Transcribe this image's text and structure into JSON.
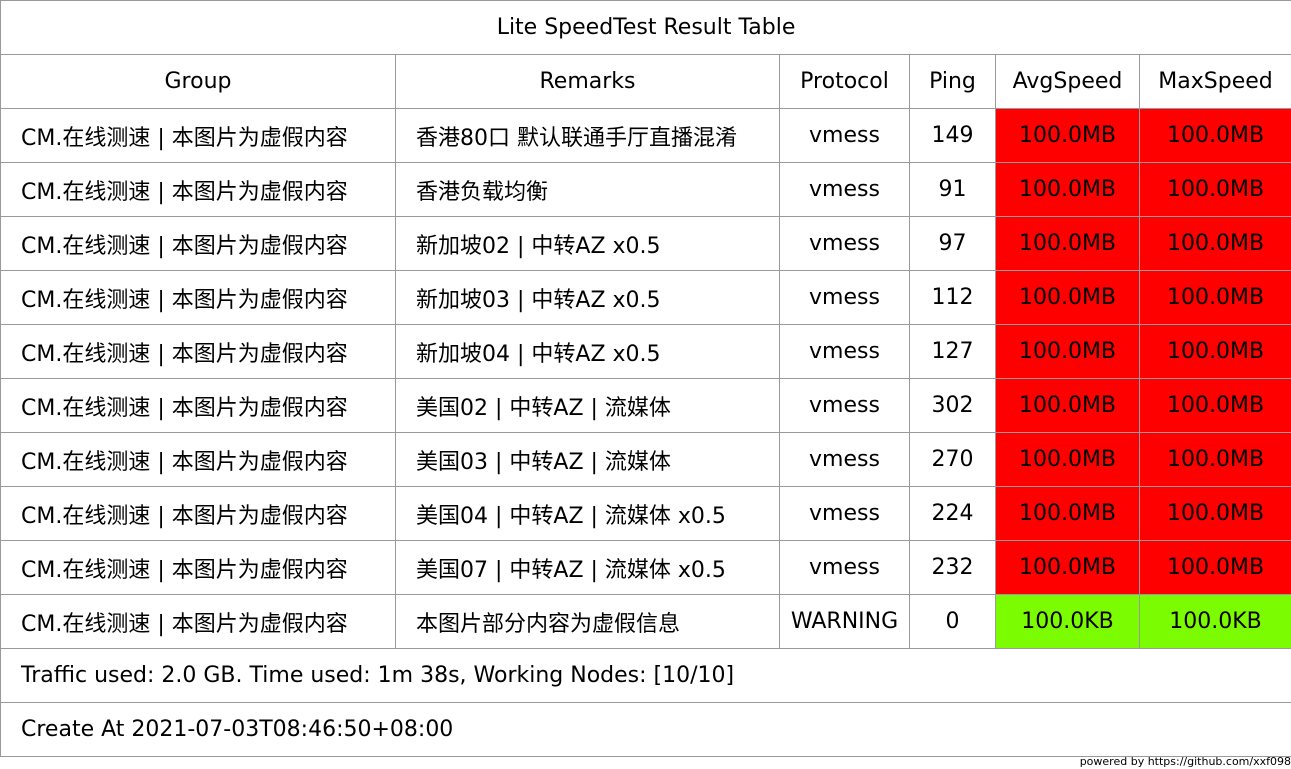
{
  "title": "Lite SpeedTest Result Table",
  "columns": [
    "Group",
    "Remarks",
    "Protocol",
    "Ping",
    "AvgSpeed",
    "MaxSpeed"
  ],
  "colors": {
    "speed_high": "#ff0000",
    "speed_low": "#7cfc00",
    "border": "#9a9a9a"
  },
  "rows": [
    {
      "group": "CM.在线测速 | 本图片为虚假内容",
      "remarks": "香港80口 默认联通手厅直播混淆",
      "protocol": "vmess",
      "ping": "149",
      "avg": "100.0MB",
      "max": "100.0MB",
      "speed_level": "high"
    },
    {
      "group": "CM.在线测速 | 本图片为虚假内容",
      "remarks": "香港负载均衡",
      "protocol": "vmess",
      "ping": "91",
      "avg": "100.0MB",
      "max": "100.0MB",
      "speed_level": "high"
    },
    {
      "group": "CM.在线测速 | 本图片为虚假内容",
      "remarks": "新加坡02 | 中转AZ x0.5",
      "protocol": "vmess",
      "ping": "97",
      "avg": "100.0MB",
      "max": "100.0MB",
      "speed_level": "high"
    },
    {
      "group": "CM.在线测速 | 本图片为虚假内容",
      "remarks": "新加坡03 | 中转AZ x0.5",
      "protocol": "vmess",
      "ping": "112",
      "avg": "100.0MB",
      "max": "100.0MB",
      "speed_level": "high"
    },
    {
      "group": "CM.在线测速 | 本图片为虚假内容",
      "remarks": "新加坡04 | 中转AZ x0.5",
      "protocol": "vmess",
      "ping": "127",
      "avg": "100.0MB",
      "max": "100.0MB",
      "speed_level": "high"
    },
    {
      "group": "CM.在线测速 | 本图片为虚假内容",
      "remarks": "美国02 | 中转AZ | 流媒体",
      "protocol": "vmess",
      "ping": "302",
      "avg": "100.0MB",
      "max": "100.0MB",
      "speed_level": "high"
    },
    {
      "group": "CM.在线测速 | 本图片为虚假内容",
      "remarks": "美国03 | 中转AZ | 流媒体",
      "protocol": "vmess",
      "ping": "270",
      "avg": "100.0MB",
      "max": "100.0MB",
      "speed_level": "high"
    },
    {
      "group": "CM.在线测速 | 本图片为虚假内容",
      "remarks": "美国04 | 中转AZ | 流媒体 x0.5",
      "protocol": "vmess",
      "ping": "224",
      "avg": "100.0MB",
      "max": "100.0MB",
      "speed_level": "high"
    },
    {
      "group": "CM.在线测速 | 本图片为虚假内容",
      "remarks": "美国07 | 中转AZ | 流媒体 x0.5",
      "protocol": "vmess",
      "ping": "232",
      "avg": "100.0MB",
      "max": "100.0MB",
      "speed_level": "high"
    },
    {
      "group": "CM.在线测速 | 本图片为虚假内容",
      "remarks": "本图片部分内容为虚假信息",
      "protocol": "WARNING",
      "ping": "0",
      "avg": "100.0KB",
      "max": "100.0KB",
      "speed_level": "low"
    }
  ],
  "footer": {
    "traffic": "Traffic used: 2.0 GB. Time used: 1m 38s, Working Nodes: [10/10]",
    "created": "Create At 2021-07-03T08:46:50+08:00",
    "powered_by": "powered by https://github.com/xxf098"
  }
}
